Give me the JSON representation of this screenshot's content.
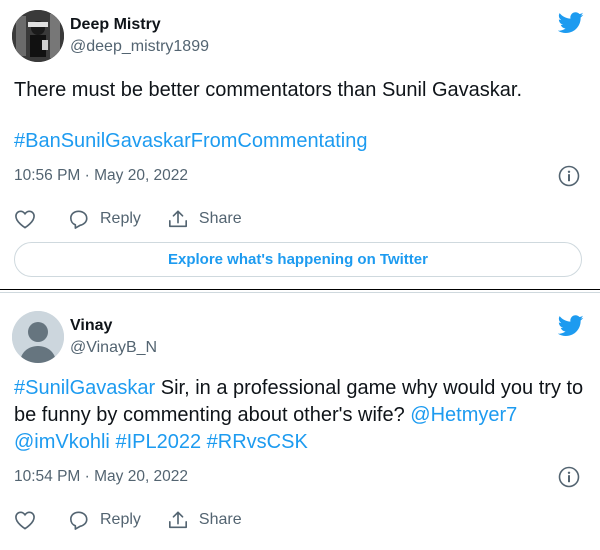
{
  "tweets": [
    {
      "author_name": "Deep Mistry",
      "author_handle": "@deep_mistry1899",
      "text_line1": "There must be better commentators than Sunil Gavaskar.",
      "hashtag_line": "#BanSunilGavaskarFromCommentating",
      "timestamp": "10:56 PM · May 20, 2022",
      "actions": {
        "reply_label": "Reply",
        "share_label": "Share"
      },
      "explore_label": "Explore what's happening on Twitter"
    },
    {
      "author_name": "Vinay",
      "author_handle": "@VinayB_N",
      "text_parts": {
        "hashtag1": "#SunilGavaskar",
        "body": " Sir, in a professional game why would you try to be funny by commenting about other's wife? ",
        "mention1": "@Hetmyer7",
        "space1": " ",
        "mention2": "@imVkohli",
        "space2": " ",
        "hashtag2": "#IPL2022",
        "space3": " ",
        "hashtag3": "#RRvsCSK"
      },
      "timestamp": "10:54 PM · May 20, 2022",
      "actions": {
        "reply_label": "Reply",
        "share_label": "Share"
      }
    }
  ],
  "icons": {
    "brand": "twitter-bird-icon",
    "info": "info-icon",
    "like": "heart-icon",
    "reply": "reply-bubble-icon",
    "share": "share-icon"
  },
  "colors": {
    "accent": "#1d9bf0",
    "text": "#0f1419",
    "secondary": "#536471",
    "border": "#cfd9de"
  }
}
